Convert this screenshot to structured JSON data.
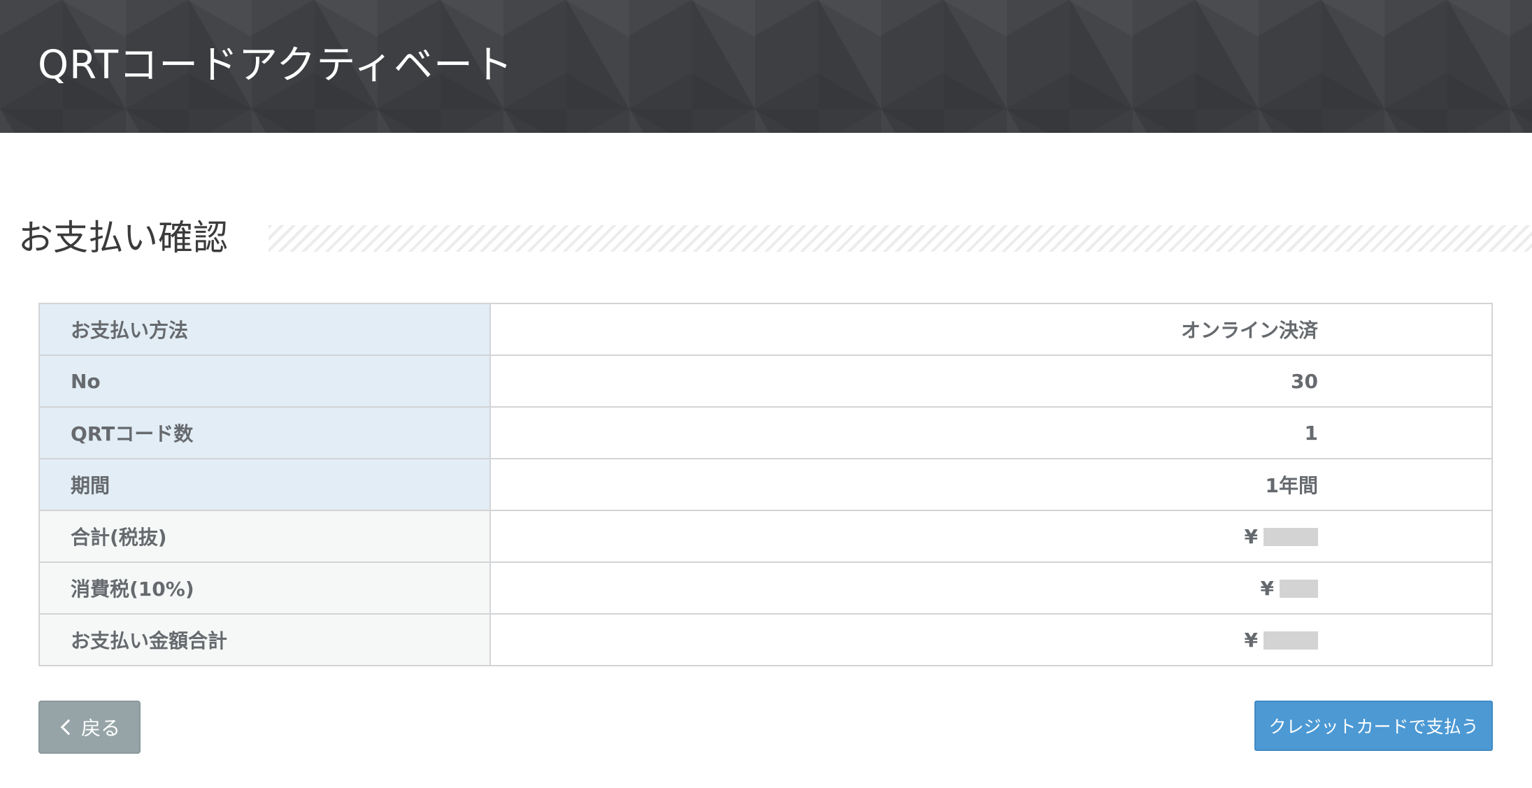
{
  "header": {
    "title": "QRTコードアクティベート"
  },
  "section": {
    "title": "お支払い確認"
  },
  "payment_table": {
    "rows": [
      {
        "label": "お支払い方法",
        "value": "オンライン決済"
      },
      {
        "label": "No",
        "value": "30"
      },
      {
        "label": "QRTコード数",
        "value": "1"
      },
      {
        "label": "期間",
        "value": "1年間"
      },
      {
        "label": "合計(税抜)",
        "currency": "¥"
      },
      {
        "label": "消費税(10%)",
        "currency": "¥"
      },
      {
        "label": "お支払い金額合計",
        "currency": "¥"
      }
    ]
  },
  "buttons": {
    "back_label": "戻る",
    "pay_label": "クレジットカードで支払う"
  },
  "icons": {
    "back": "chevron-left-icon"
  },
  "colors": {
    "header_bg": "#3d3f43",
    "label_bg_blue": "#e2edf5",
    "label_bg_gray": "#f6f8f8",
    "back_button": "#96a4a8",
    "pay_button": "#4c99d4"
  }
}
